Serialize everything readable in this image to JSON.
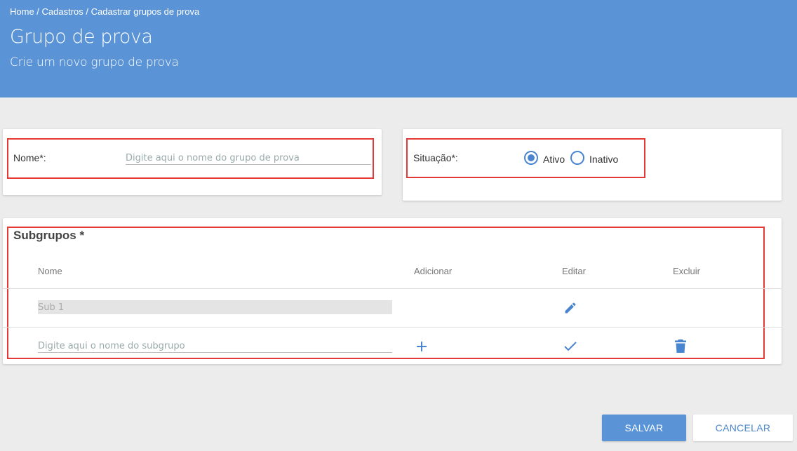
{
  "header": {
    "breadcrumb": "Home / Cadastros / Cadastrar grupos de prova",
    "title": "Grupo de prova",
    "subtitle": "Crie um novo grupo de prova"
  },
  "form": {
    "name_label": "Nome*:",
    "name_placeholder": "Digite aqui o nome do grupo de prova",
    "status_label": "Situação*:",
    "status_options": [
      {
        "label": "Ativo",
        "checked": true
      },
      {
        "label": "Inativo",
        "checked": false
      }
    ]
  },
  "subgroups": {
    "title": "Subgrupos *",
    "columns": [
      "Nome",
      "Adicionar",
      "Editar",
      "Excluir"
    ],
    "rows": [
      {
        "name": "Sub 1",
        "icons": [
          "pencil-icon"
        ]
      }
    ],
    "new_placeholder": "Digite aqui o nome do subgrupo",
    "new_row_icons": [
      "plus-icon",
      "check-icon",
      "trash-icon"
    ]
  },
  "actions": {
    "save": "SALVAR",
    "cancel": "CANCELAR"
  },
  "colors": {
    "header": "#5a93d6",
    "accent": "#4a86d0",
    "highlight": "#e53935"
  }
}
